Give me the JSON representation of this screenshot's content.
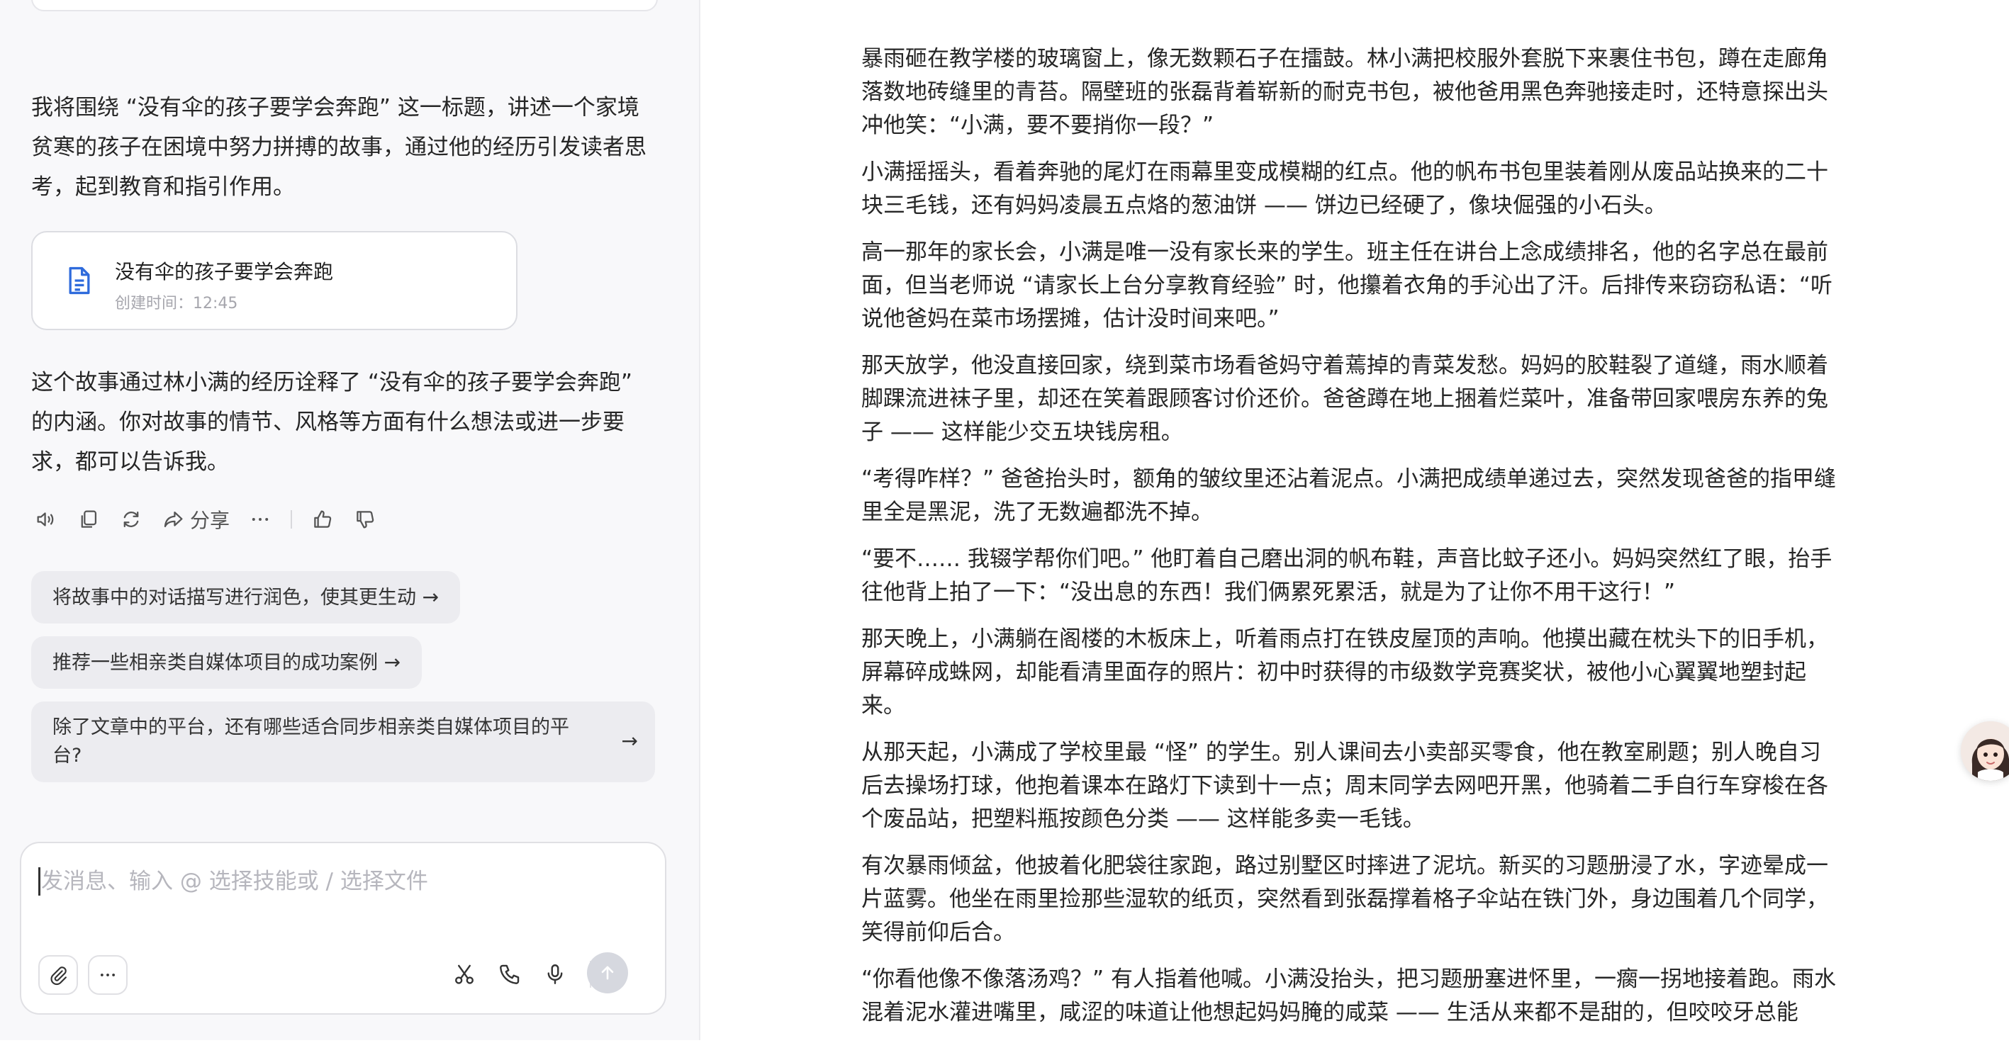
{
  "chat": {
    "intro_text": "我将围绕 “没有伞的孩子要学会奔跑” 这一标题，讲述一个家境贫寒的孩子在困境中努力拼搏的故事，通过他的经历引发读者思考，起到教育和指引作用。",
    "doc_card": {
      "title": "没有伞的孩子要学会奔跑",
      "time": "创建时间：12:45",
      "icon": "document-icon"
    },
    "followup_text": "这个故事通过林小满的经历诠释了 “没有伞的孩子要学会奔跑” 的内涵。你对故事的情节、风格等方面有什么想法或进一步要求，都可以告诉我。",
    "actions": {
      "share_label": "分享",
      "icons": [
        "speaker-icon",
        "copy-icon",
        "regenerate-icon",
        "share-icon",
        "more-icon",
        "thumbs-up-icon",
        "thumbs-down-icon"
      ]
    },
    "suggestions": [
      "将故事中的对话描写进行润色，使其更生动",
      "推荐一些相亲类自媒体项目的成功案例",
      "除了文章中的平台，还有哪些适合同步相亲类自媒体项目的平台?"
    ],
    "input": {
      "placeholder": "发消息、输入 @ 选择技能或 / 选择文件"
    }
  },
  "article": {
    "paragraphs": [
      "暴雨砸在教学楼的玻璃窗上，像无数颗石子在擂鼓。林小满把校服外套脱下来裹住书包，蹲在走廊角落数地砖缝里的青苔。隔壁班的张磊背着崭新的耐克书包，被他爸用黑色奔驰接走时，还特意探出头冲他笑：“小满，要不要捎你一段？”",
      "小满摇摇头，看着奔驰的尾灯在雨幕里变成模糊的红点。他的帆布书包里装着刚从废品站换来的二十块三毛钱，还有妈妈凌晨五点烙的葱油饼 —— 饼边已经硬了，像块倔强的小石头。",
      "高一那年的家长会，小满是唯一没有家长来的学生。班主任在讲台上念成绩排名，他的名字总在最前面，但当老师说 “请家长上台分享教育经验” 时，他攥着衣角的手沁出了汗。后排传来窃窃私语：“听说他爸妈在菜市场摆摊，估计没时间来吧。”",
      "那天放学，他没直接回家，绕到菜市场看爸妈守着蔫掉的青菜发愁。妈妈的胶鞋裂了道缝，雨水顺着脚踝流进袜子里，却还在笑着跟顾客讨价还价。爸爸蹲在地上捆着烂菜叶，准备带回家喂房东养的兔子 —— 这样能少交五块钱房租。",
      "“考得咋样？” 爸爸抬头时，额角的皱纹里还沾着泥点。小满把成绩单递过去，突然发现爸爸的指甲缝里全是黑泥，洗了无数遍都洗不掉。",
      "“要不…… 我辍学帮你们吧。” 他盯着自己磨出洞的帆布鞋，声音比蚊子还小。妈妈突然红了眼，抬手往他背上拍了一下：“没出息的东西！我们俩累死累活，就是为了让你不用干这行！”",
      "那天晚上，小满躺在阁楼的木板床上，听着雨点打在铁皮屋顶的声响。他摸出藏在枕头下的旧手机，屏幕碎成蛛网，却能看清里面存的照片：初中时获得的市级数学竞赛奖状，被他小心翼翼地塑封起来。",
      "从那天起，小满成了学校里最 “怪” 的学生。别人课间去小卖部买零食，他在教室刷题；别人晚自习后去操场打球，他抱着课本在路灯下读到十一点；周末同学去网吧开黑，他骑着二手自行车穿梭在各个废品站，把塑料瓶按颜色分类 —— 这样能多卖一毛钱。",
      "有次暴雨倾盆，他披着化肥袋往家跑，路过别墅区时摔进了泥坑。新买的习题册浸了水，字迹晕成一片蓝雾。他坐在雨里捡那些湿软的纸页，突然看到张磊撑着格子伞站在铁门外，身边围着几个同学，笑得前仰后合。",
      "“你看他像不像落汤鸡？” 有人指着他喊。小满没抬头，把习题册塞进怀里，一瘸一拐地接着跑。雨水混着泥水灌进嘴里，咸涩的味道让他想起妈妈腌的咸菜 —— 生活从来都不是甜的，但咬咬牙总能"
    ]
  },
  "avatar": {
    "icon": "assistant-avatar-icon"
  },
  "colors": {
    "accent": "#2f6bdc",
    "panel_bg": "#f8f8fa",
    "suggestion_bg": "#ececf0"
  }
}
